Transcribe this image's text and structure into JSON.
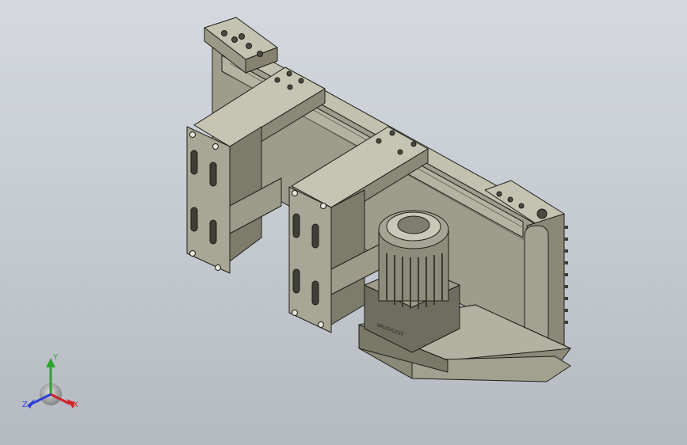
{
  "viewport": {
    "background_top": "#d5d9df",
    "background_bottom": "#b5bac1",
    "part_color": "#a9a795",
    "part_shade": "#8f8d7c",
    "part_light": "#c8c6b6",
    "edge_color": "#1e1e1a"
  },
  "model": {
    "motor_label": "BRUSHLESS"
  },
  "triad": {
    "x_label": "X",
    "y_label": "Y",
    "z_label": "Z",
    "x_color": "#d0212b",
    "y_color": "#2fa32f",
    "z_color": "#2d3fd6"
  }
}
